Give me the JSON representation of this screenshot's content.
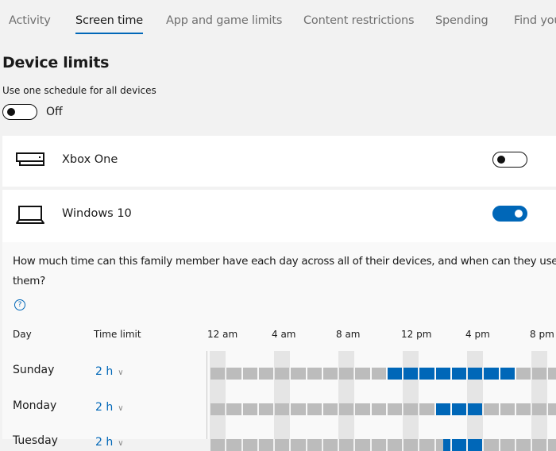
{
  "tabs": [
    {
      "label": "Activity",
      "active": false
    },
    {
      "label": "Screen time",
      "active": true
    },
    {
      "label": "App and game limits",
      "active": false
    },
    {
      "label": "Content restrictions",
      "active": false
    },
    {
      "label": "Spending",
      "active": false
    },
    {
      "label": "Find your child",
      "active": false
    }
  ],
  "page": {
    "title": "Device limits",
    "schedule_label": "Use one schedule for all devices",
    "schedule_toggle": {
      "state": "off",
      "label": "Off"
    }
  },
  "devices": [
    {
      "name": "Xbox One",
      "icon": "xbox-console-icon",
      "enabled": false
    },
    {
      "name": "Windows 10",
      "icon": "laptop-icon",
      "enabled": true
    }
  ],
  "schedule": {
    "question": "How much time can this family member have each day across all of their devices, and when can they use them?",
    "help_icon": "help-circle-icon",
    "headers": {
      "day": "Day",
      "time_limit": "Time limit"
    },
    "hour_labels": [
      "12 am",
      "4 am",
      "8 am",
      "12 pm",
      "4 pm",
      "8 pm"
    ],
    "rows": [
      {
        "day": "Sunday",
        "limit": "2 h",
        "allowed_from_hour": 11,
        "allowed_to_hour": 19
      },
      {
        "day": "Monday",
        "limit": "2 h",
        "allowed_from_hour": 14,
        "allowed_to_hour": 17
      },
      {
        "day": "Tuesday",
        "limit": "2 h",
        "allowed_from_hour": 14.5,
        "allowed_to_hour": 17
      }
    ],
    "colors": {
      "allowed": "#0067b8",
      "blocked": "#bcbcbc",
      "accent": "#0067b8"
    }
  }
}
